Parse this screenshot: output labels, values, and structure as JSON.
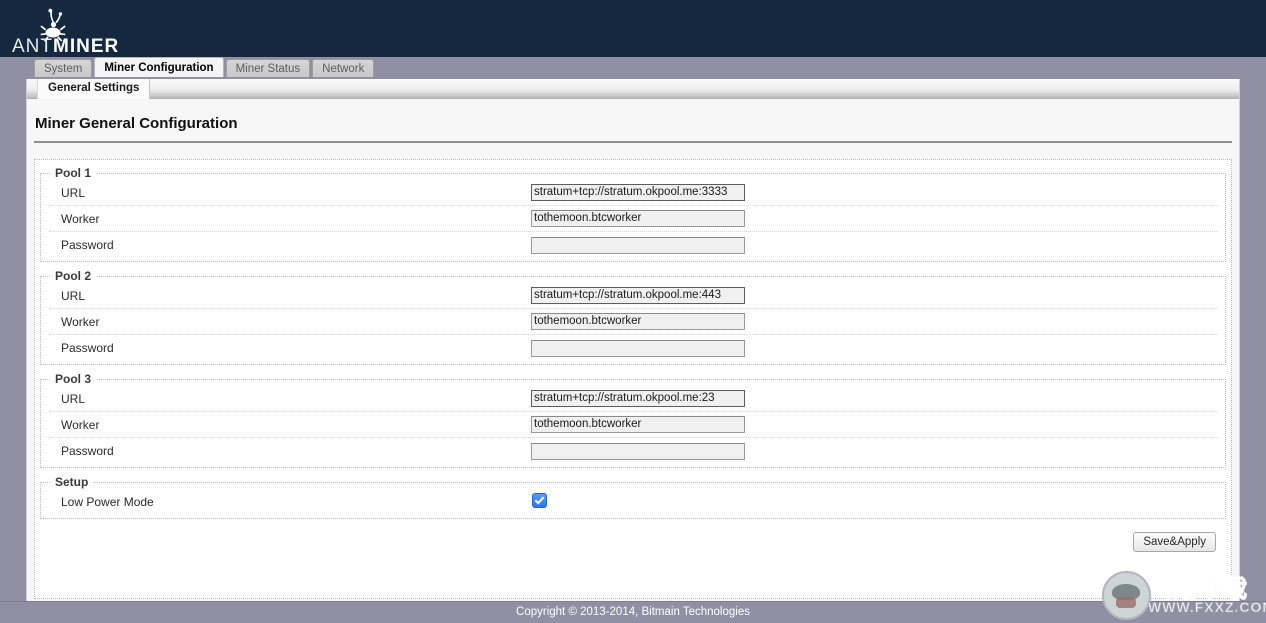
{
  "brand": {
    "name_light": "ANT",
    "name_bold": "MINER",
    "logo_icon": "ant-icon"
  },
  "tabs": [
    {
      "label": "System",
      "active": false
    },
    {
      "label": "Miner Configuration",
      "active": true
    },
    {
      "label": "Miner Status",
      "active": false
    },
    {
      "label": "Network",
      "active": false
    }
  ],
  "subtabs": [
    {
      "label": "General Settings",
      "active": true
    }
  ],
  "page": {
    "title": "Miner General Configuration"
  },
  "pools": [
    {
      "legend": "Pool 1",
      "url_label": "URL",
      "url_value": "stratum+tcp://stratum.okpool.me:3333",
      "worker_label": "Worker",
      "worker_value": "tothemoon.btcworker",
      "password_label": "Password",
      "password_value": ""
    },
    {
      "legend": "Pool 2",
      "url_label": "URL",
      "url_value": "stratum+tcp://stratum.okpool.me:443",
      "worker_label": "Worker",
      "worker_value": "tothemoon.btcworker",
      "password_label": "Password",
      "password_value": ""
    },
    {
      "legend": "Pool 3",
      "url_label": "URL",
      "url_value": "stratum+tcp://stratum.okpool.me:23",
      "worker_label": "Worker",
      "worker_value": "tothemoon.btcworker",
      "password_label": "Password",
      "password_value": ""
    }
  ],
  "setup": {
    "legend": "Setup",
    "low_power_label": "Low Power Mode",
    "low_power_checked": true
  },
  "actions": {
    "apply_label": "Save&Apply"
  },
  "footer": {
    "copyright": "Copyright © 2013-2014, Bitmain Technologies"
  },
  "watermark": {
    "cn_text": "飞翔下载",
    "url_text": "WWW.FXXZ.COM"
  },
  "colors": {
    "header_bg": "#14293f",
    "band_bg": "#908fa3",
    "panel_bg": "#f7f7f7",
    "checkbox_blue": "#2f74e8",
    "watermark_cyan": "#46c2f0"
  }
}
